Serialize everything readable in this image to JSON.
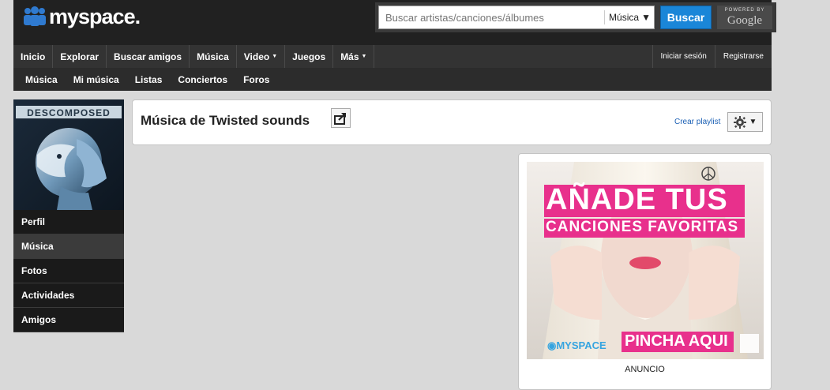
{
  "header": {
    "logo_text": "myspace.",
    "search": {
      "placeholder": "Buscar artistas/canciones/álbumes",
      "category": "Música",
      "button": "Buscar",
      "powered_by": "POWERED BY",
      "powered_brand": "Google"
    }
  },
  "nav_main": {
    "items": [
      "Inicio",
      "Explorar",
      "Buscar amigos",
      "Música",
      "Video",
      "Juegos",
      "Más"
    ],
    "right": [
      "Iniciar sesión",
      "Registrarse"
    ]
  },
  "nav_sub": {
    "items": [
      "Música",
      "Mi música",
      "Listas",
      "Conciertos",
      "Foros"
    ]
  },
  "profile": {
    "album_text": "DESCOMPOSED"
  },
  "side_menu": {
    "items": [
      "Perfil",
      "Música",
      "Fotos",
      "Actividades",
      "Amigos"
    ],
    "active": "Música"
  },
  "main": {
    "title": "Música de Twisted sounds",
    "create_playlist": "Crear playlist"
  },
  "ad": {
    "line1": "AÑADE TUS",
    "line2": "CANCIONES FAVORITAS",
    "brand": "MYSPACE",
    "cta": "PINCHA AQUI",
    "label": "ANUNCIO"
  },
  "colors": {
    "accent": "#1a86d8",
    "ad_pink": "#e8308c"
  }
}
